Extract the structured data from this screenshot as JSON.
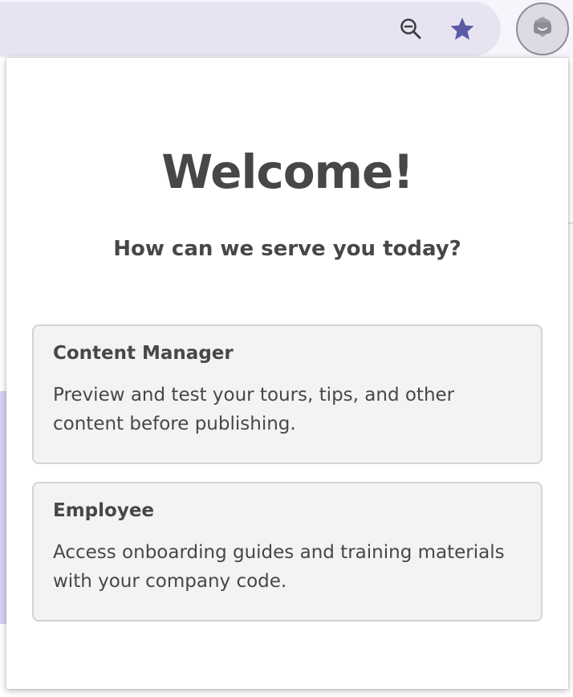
{
  "toolbar": {
    "zoom_icon": "zoom-out-icon",
    "bookmark_icon": "star-icon",
    "extension_icon": "bot-extension-icon",
    "star_color": "#5a5aa6"
  },
  "popup": {
    "title": "Welcome!",
    "subtitle": "How can we serve you today?",
    "options": [
      {
        "title": "Content Manager",
        "description": "Preview and test your tours, tips, and other content before publishing."
      },
      {
        "title": "Employee",
        "description": "Access onboarding guides and training materials with your company code."
      }
    ]
  }
}
